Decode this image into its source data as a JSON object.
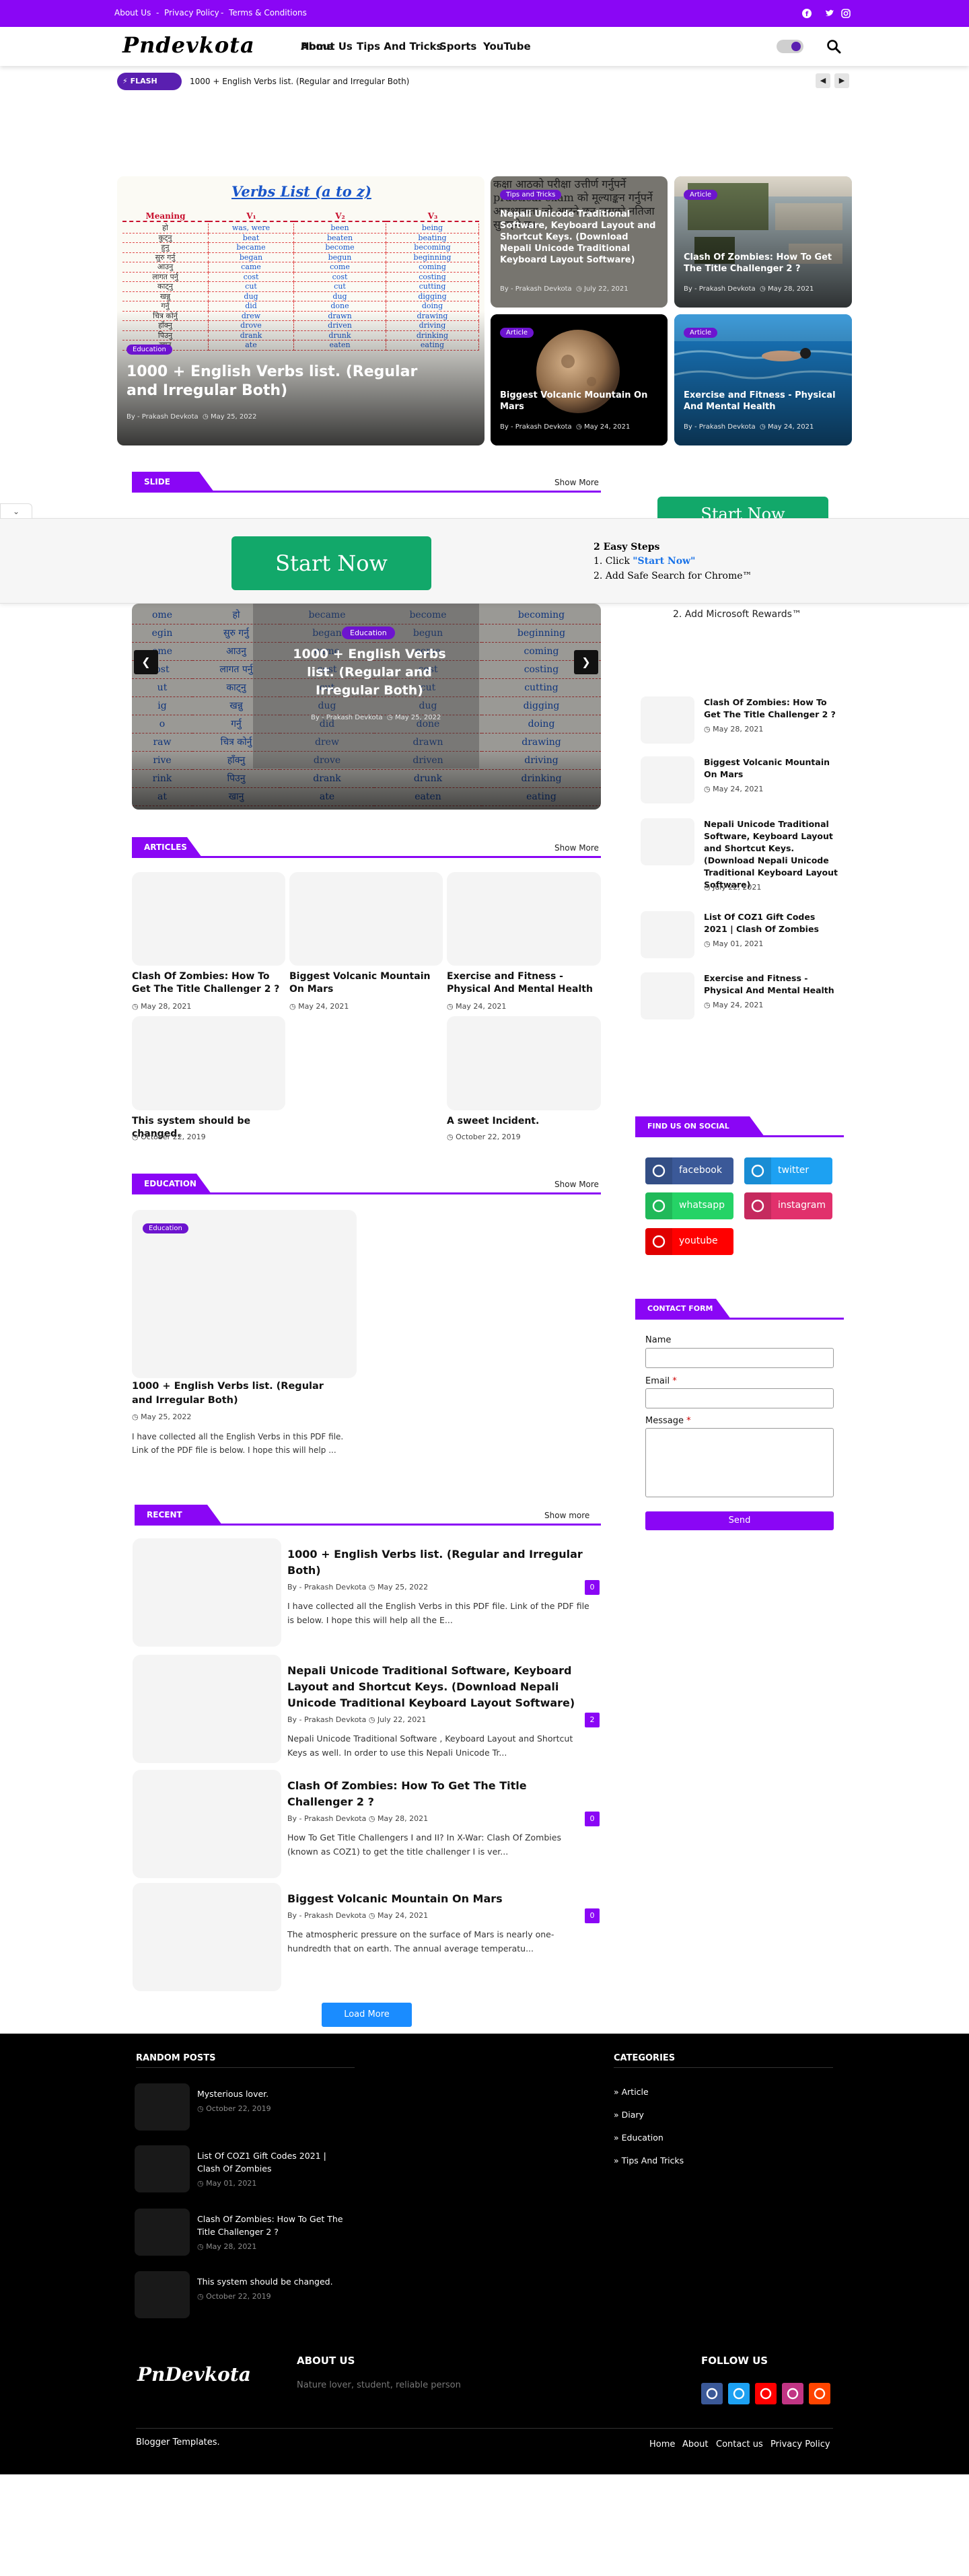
{
  "topbar": {
    "links": [
      "About Us",
      "Privacy Policy",
      "Terms & Conditions"
    ],
    "social_icons": [
      "facebook-icon",
      "twitter-icon",
      "instagram-icon"
    ],
    "color": "#8a06f5"
  },
  "header": {
    "logo": "Pndevkota",
    "nav": [
      "Home",
      "About Us",
      "Tips And Tricks",
      "Sports",
      "YouTube"
    ]
  },
  "flash": {
    "badge": "FLASH NEWS",
    "text": "1000 + English Verbs list. (Regular and Irregular Both)"
  },
  "hero": {
    "main": {
      "image_heading": "Verbs List (a to z)",
      "table_headers": [
        "Meaning",
        "V₁",
        "V₂",
        "V₃"
      ],
      "table_rows": [
        [
          "हो",
          "was, were",
          "been",
          "being"
        ],
        [
          "कुट्नु",
          "beat",
          "beaten",
          "beating"
        ],
        [
          "हुनु",
          "became",
          "become",
          "becoming"
        ],
        [
          "सुरु गर्नु",
          "began",
          "begun",
          "beginning"
        ],
        [
          "आउनु",
          "came",
          "come",
          "coming"
        ],
        [
          "लागत पर्नु",
          "cost",
          "cost",
          "costing"
        ],
        [
          "काट्नु",
          "cut",
          "cut",
          "cutting"
        ],
        [
          "खन्नु",
          "dug",
          "dug",
          "digging"
        ],
        [
          "गर्नु",
          "did",
          "done",
          "doing"
        ],
        [
          "चित्र कोर्नु",
          "drew",
          "drawn",
          "drawing"
        ],
        [
          "हाँक्नु",
          "drove",
          "driven",
          "driving"
        ],
        [
          "पिउनु",
          "drank",
          "drunk",
          "drinking"
        ],
        [
          "खानु",
          "ate",
          "eaten",
          "eating"
        ]
      ],
      "badge": "Education",
      "title": "1000 + English Verbs list. (Regular and Irregular Both)",
      "author": "By - Prakash Devkota",
      "date": "May 25, 2022"
    },
    "tiles": [
      {
        "badge": "Tips and Tricks",
        "title": "Nepali Unicode Traditional Software, Keyboard Layout and Shortcut Keys. (Download Nepali Unicode Traditional Keyboard Layout Software)",
        "author": "By - Prakash Devkota",
        "date": "July 22, 2021"
      },
      {
        "badge": "Article",
        "title": "Clash Of Zombies: How To Get The Title Challenger 2 ?",
        "author": "By - Prakash Devkota",
        "date": "May 28, 2021"
      },
      {
        "badge": "Article",
        "title": "Biggest Volcanic Mountain On Mars",
        "author": "By - Prakash Devkota",
        "date": "May 24, 2021"
      },
      {
        "badge": "Article",
        "title": "Exercise and Fitness - Physical And Mental Health",
        "author": "By - Prakash Devkota",
        "date": "May 24, 2021"
      }
    ]
  },
  "slideshow": {
    "label": "SLIDE SHOW",
    "show_more": "Show More",
    "badge": "Education",
    "title": "1000 + English Verbs list. (Regular and Irregular Both)",
    "author": "By - Prakash Devkota",
    "date": "May 25, 2022",
    "bg_rows": [
      [
        "ome",
        "हो",
        "became",
        "become",
        "becoming"
      ],
      [
        "egin",
        "सुरु गर्नु",
        "began",
        "begun",
        "beginning"
      ],
      [
        "ome",
        "आउनु",
        "came",
        "come",
        "coming"
      ],
      [
        "ost",
        "लागत पर्नु",
        "cost",
        "cost",
        "costing"
      ],
      [
        "ut",
        "काट्नु",
        "cut",
        "cut",
        "cutting"
      ],
      [
        "ig",
        "खन्नु",
        "dug",
        "dug",
        "digging"
      ],
      [
        "o",
        "गर्नु",
        "did",
        "done",
        "doing"
      ],
      [
        "raw",
        "चित्र कोर्नु",
        "drew",
        "drawn",
        "drawing"
      ],
      [
        "rive",
        "हाँक्नु",
        "drove",
        "driven",
        "driving"
      ],
      [
        "rink",
        "पिउनु",
        "drank",
        "drunk",
        "drinking"
      ],
      [
        "at",
        "खानु",
        "ate",
        "eaten",
        "eating"
      ]
    ]
  },
  "ad": {
    "button": "Start Now",
    "steps_title": "2 Easy Steps",
    "step1_prefix": "1. Click ",
    "step1_link": "\"Start Now\"",
    "step2": "2. Add Safe Search for Chrome™",
    "side_button": "Start Now",
    "side_step": "2. Add Microsoft Rewards™"
  },
  "articles": {
    "label": "ARTICLES",
    "show_more": "Show More",
    "items": [
      {
        "title": "Clash Of Zombies: How To Get The Title Challenger 2 ?",
        "date": "May 28, 2021"
      },
      {
        "title": "Biggest Volcanic Mountain On Mars",
        "date": "May 24, 2021"
      },
      {
        "title": "Exercise and Fitness - Physical And Mental Health",
        "date": "May 24, 2021"
      },
      {
        "title": "This system should be changed.",
        "date": "October 22, 2019"
      },
      {
        "title": "A sweet Incident.",
        "date": "October 22, 2019"
      }
    ]
  },
  "education": {
    "label": "EDUCATION",
    "show_more": "Show More",
    "badge": "Education",
    "title": "1000 + English Verbs list. (Regular and Irregular Both)",
    "date": "May 25, 2022",
    "excerpt": "I have collected all the English Verbs in this PDF file. Link of the PDF file is below. I hope this will help ..."
  },
  "recent": {
    "label": "RECENT POSTS",
    "show_more": "Show more",
    "load_more": "Load More",
    "items": [
      {
        "title": "1000 + English Verbs list. (Regular and Irregular Both)",
        "author": "By - Prakash Devkota",
        "date": "May 25, 2022",
        "excerpt": "I have collected all the English Verbs in this PDF file. Link of the PDF file is below. I hope this will help all the E...",
        "count": "0"
      },
      {
        "title": "Nepali Unicode Traditional Software, Keyboard Layout and Shortcut Keys. (Download Nepali Unicode Traditional Keyboard Layout Software)",
        "author": "By - Prakash Devkota",
        "date": "July 22, 2021",
        "excerpt": "Nepali Unicode Traditional Software , Keyboard Layout and Shortcut Keys as well. In order to use this Nepali Unicode Tr...",
        "count": "2"
      },
      {
        "title": "Clash Of Zombies: How To Get The Title Challenger 2 ?",
        "author": "By - Prakash Devkota",
        "date": "May 28, 2021",
        "excerpt": "How To Get Title Challengers I and II?  In X-War: Clash Of Zombies (known as COZ1) to get the title challenger I is ver...",
        "count": "0"
      },
      {
        "title": "Biggest Volcanic Mountain On Mars",
        "author": "By - Prakash Devkota",
        "date": "May 24, 2021",
        "excerpt": "The atmospheric pressure on the surface of Mars is nearly one- hundredth that on earth. The annual average temperatu...",
        "count": "0"
      }
    ]
  },
  "sidebar": {
    "popular": [
      {
        "title": "Clash Of Zombies: How To Get The Title Challenger 2 ?",
        "date": "May 28, 2021"
      },
      {
        "title": "Biggest Volcanic Mountain On Mars",
        "date": "May 24, 2021"
      },
      {
        "title": "Nepali Unicode Traditional Software, Keyboard Layout and Shortcut Keys. (Download Nepali Unicode Traditional Keyboard Layout Software)",
        "date": "July 22, 2021"
      },
      {
        "title": "List Of COZ1 Gift Codes 2021 | Clash Of Zombies",
        "date": "May 01, 2021"
      },
      {
        "title": "Exercise and Fitness - Physical And Mental Health",
        "date": "May 24, 2021"
      }
    ],
    "social_label": "FIND US ON SOCIAL MEDIA",
    "social": [
      {
        "name": "facebook",
        "color": "#3b5998"
      },
      {
        "name": "twitter",
        "color": "#1da1f2"
      },
      {
        "name": "whatsapp",
        "color": "#25d366"
      },
      {
        "name": "instagram",
        "color": "#e1306c"
      },
      {
        "name": "youtube",
        "color": "#ff0000"
      }
    ],
    "contact_label": "CONTACT FORM",
    "name_label": "Name",
    "email_label": "Email",
    "message_label": "Message",
    "required_mark": "*",
    "send": "Send"
  },
  "footer": {
    "random_label": "RANDOM POSTS",
    "random": [
      {
        "title": "Mysterious lover.",
        "date": "October 22, 2019"
      },
      {
        "title": "List Of COZ1 Gift Codes 2021 | Clash Of Zombies",
        "date": "May 01, 2021"
      },
      {
        "title": "Clash Of Zombies: How To Get The Title Challenger 2 ?",
        "date": "May 28, 2021"
      },
      {
        "title": "This system should be changed.",
        "date": "October 22, 2019"
      }
    ],
    "categories_label": "CATEGORIES",
    "categories": [
      "Article",
      "Diary",
      "Education",
      "Tips And Tricks"
    ],
    "logo": "PnDevkota",
    "about_label": "ABOUT US",
    "about_text": "Nature lover, student, reliable person",
    "follow_label": "FOLLOW US",
    "follow": [
      {
        "icon": "facebook-icon",
        "color": "#3b5998"
      },
      {
        "icon": "twitter-icon",
        "color": "#1da1f2"
      },
      {
        "icon": "youtube-icon",
        "color": "#ff0000"
      },
      {
        "icon": "instagram-icon",
        "color": "#c13584"
      },
      {
        "icon": "reddit-icon",
        "color": "#ff4500"
      }
    ],
    "credit": "Blogger Templates.",
    "links": [
      "Home",
      "About",
      "Contact us",
      "Privacy Policy"
    ]
  }
}
